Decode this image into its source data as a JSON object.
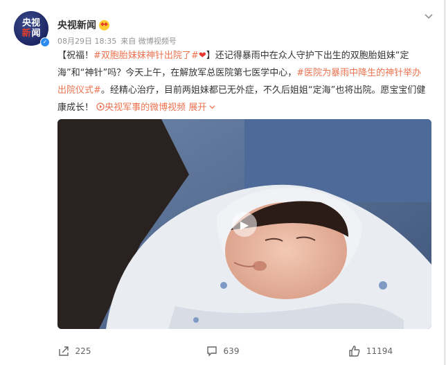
{
  "post": {
    "author": "央视新闻",
    "time": "08月29日 18:35",
    "source": "来自 微博视频号",
    "avatar_line1": "央视",
    "avatar_line2a": "新",
    "avatar_line2b": "闻",
    "text_prefix": "【祝福！",
    "tag1": "#双胞胎妹妹神针出院了#",
    "text_mid1": "】还记得暴雨中在众人守护下出生的双胞胎姐妹“定海”和“神针”吗？今天上午，在解放军总医院第七医学中心，",
    "tag2": "#医院为暴雨中降生的神针举办出院仪式#",
    "text_mid2": "。经精心治疗，目前两姐妹都已无外症，不久后姐姐“定海”也将出院。愿宝宝们健康成长！",
    "video_link": "央视军事的微博视频",
    "expand": "展开",
    "accent_color": "#eb7350"
  },
  "actions": {
    "share_count": "225",
    "comment_count": "639",
    "like_count": "11194"
  }
}
